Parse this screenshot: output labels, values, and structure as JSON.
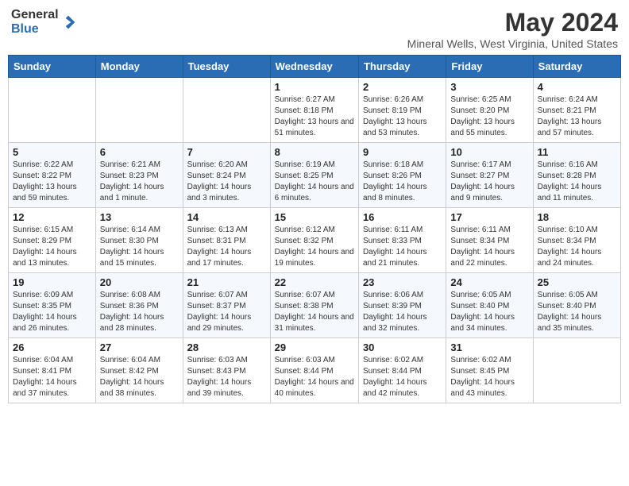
{
  "header": {
    "logo_general": "General",
    "logo_blue": "Blue",
    "main_title": "May 2024",
    "subtitle": "Mineral Wells, West Virginia, United States"
  },
  "days_of_week": [
    "Sunday",
    "Monday",
    "Tuesday",
    "Wednesday",
    "Thursday",
    "Friday",
    "Saturday"
  ],
  "weeks": [
    [
      {
        "day": "",
        "sunrise": "",
        "sunset": "",
        "daylight": ""
      },
      {
        "day": "",
        "sunrise": "",
        "sunset": "",
        "daylight": ""
      },
      {
        "day": "",
        "sunrise": "",
        "sunset": "",
        "daylight": ""
      },
      {
        "day": "1",
        "sunrise": "Sunrise: 6:27 AM",
        "sunset": "Sunset: 8:18 PM",
        "daylight": "Daylight: 13 hours and 51 minutes."
      },
      {
        "day": "2",
        "sunrise": "Sunrise: 6:26 AM",
        "sunset": "Sunset: 8:19 PM",
        "daylight": "Daylight: 13 hours and 53 minutes."
      },
      {
        "day": "3",
        "sunrise": "Sunrise: 6:25 AM",
        "sunset": "Sunset: 8:20 PM",
        "daylight": "Daylight: 13 hours and 55 minutes."
      },
      {
        "day": "4",
        "sunrise": "Sunrise: 6:24 AM",
        "sunset": "Sunset: 8:21 PM",
        "daylight": "Daylight: 13 hours and 57 minutes."
      }
    ],
    [
      {
        "day": "5",
        "sunrise": "Sunrise: 6:22 AM",
        "sunset": "Sunset: 8:22 PM",
        "daylight": "Daylight: 13 hours and 59 minutes."
      },
      {
        "day": "6",
        "sunrise": "Sunrise: 6:21 AM",
        "sunset": "Sunset: 8:23 PM",
        "daylight": "Daylight: 14 hours and 1 minute."
      },
      {
        "day": "7",
        "sunrise": "Sunrise: 6:20 AM",
        "sunset": "Sunset: 8:24 PM",
        "daylight": "Daylight: 14 hours and 3 minutes."
      },
      {
        "day": "8",
        "sunrise": "Sunrise: 6:19 AM",
        "sunset": "Sunset: 8:25 PM",
        "daylight": "Daylight: 14 hours and 6 minutes."
      },
      {
        "day": "9",
        "sunrise": "Sunrise: 6:18 AM",
        "sunset": "Sunset: 8:26 PM",
        "daylight": "Daylight: 14 hours and 8 minutes."
      },
      {
        "day": "10",
        "sunrise": "Sunrise: 6:17 AM",
        "sunset": "Sunset: 8:27 PM",
        "daylight": "Daylight: 14 hours and 9 minutes."
      },
      {
        "day": "11",
        "sunrise": "Sunrise: 6:16 AM",
        "sunset": "Sunset: 8:28 PM",
        "daylight": "Daylight: 14 hours and 11 minutes."
      }
    ],
    [
      {
        "day": "12",
        "sunrise": "Sunrise: 6:15 AM",
        "sunset": "Sunset: 8:29 PM",
        "daylight": "Daylight: 14 hours and 13 minutes."
      },
      {
        "day": "13",
        "sunrise": "Sunrise: 6:14 AM",
        "sunset": "Sunset: 8:30 PM",
        "daylight": "Daylight: 14 hours and 15 minutes."
      },
      {
        "day": "14",
        "sunrise": "Sunrise: 6:13 AM",
        "sunset": "Sunset: 8:31 PM",
        "daylight": "Daylight: 14 hours and 17 minutes."
      },
      {
        "day": "15",
        "sunrise": "Sunrise: 6:12 AM",
        "sunset": "Sunset: 8:32 PM",
        "daylight": "Daylight: 14 hours and 19 minutes."
      },
      {
        "day": "16",
        "sunrise": "Sunrise: 6:11 AM",
        "sunset": "Sunset: 8:33 PM",
        "daylight": "Daylight: 14 hours and 21 minutes."
      },
      {
        "day": "17",
        "sunrise": "Sunrise: 6:11 AM",
        "sunset": "Sunset: 8:34 PM",
        "daylight": "Daylight: 14 hours and 22 minutes."
      },
      {
        "day": "18",
        "sunrise": "Sunrise: 6:10 AM",
        "sunset": "Sunset: 8:34 PM",
        "daylight": "Daylight: 14 hours and 24 minutes."
      }
    ],
    [
      {
        "day": "19",
        "sunrise": "Sunrise: 6:09 AM",
        "sunset": "Sunset: 8:35 PM",
        "daylight": "Daylight: 14 hours and 26 minutes."
      },
      {
        "day": "20",
        "sunrise": "Sunrise: 6:08 AM",
        "sunset": "Sunset: 8:36 PM",
        "daylight": "Daylight: 14 hours and 28 minutes."
      },
      {
        "day": "21",
        "sunrise": "Sunrise: 6:07 AM",
        "sunset": "Sunset: 8:37 PM",
        "daylight": "Daylight: 14 hours and 29 minutes."
      },
      {
        "day": "22",
        "sunrise": "Sunrise: 6:07 AM",
        "sunset": "Sunset: 8:38 PM",
        "daylight": "Daylight: 14 hours and 31 minutes."
      },
      {
        "day": "23",
        "sunrise": "Sunrise: 6:06 AM",
        "sunset": "Sunset: 8:39 PM",
        "daylight": "Daylight: 14 hours and 32 minutes."
      },
      {
        "day": "24",
        "sunrise": "Sunrise: 6:05 AM",
        "sunset": "Sunset: 8:40 PM",
        "daylight": "Daylight: 14 hours and 34 minutes."
      },
      {
        "day": "25",
        "sunrise": "Sunrise: 6:05 AM",
        "sunset": "Sunset: 8:40 PM",
        "daylight": "Daylight: 14 hours and 35 minutes."
      }
    ],
    [
      {
        "day": "26",
        "sunrise": "Sunrise: 6:04 AM",
        "sunset": "Sunset: 8:41 PM",
        "daylight": "Daylight: 14 hours and 37 minutes."
      },
      {
        "day": "27",
        "sunrise": "Sunrise: 6:04 AM",
        "sunset": "Sunset: 8:42 PM",
        "daylight": "Daylight: 14 hours and 38 minutes."
      },
      {
        "day": "28",
        "sunrise": "Sunrise: 6:03 AM",
        "sunset": "Sunset: 8:43 PM",
        "daylight": "Daylight: 14 hours and 39 minutes."
      },
      {
        "day": "29",
        "sunrise": "Sunrise: 6:03 AM",
        "sunset": "Sunset: 8:44 PM",
        "daylight": "Daylight: 14 hours and 40 minutes."
      },
      {
        "day": "30",
        "sunrise": "Sunrise: 6:02 AM",
        "sunset": "Sunset: 8:44 PM",
        "daylight": "Daylight: 14 hours and 42 minutes."
      },
      {
        "day": "31",
        "sunrise": "Sunrise: 6:02 AM",
        "sunset": "Sunset: 8:45 PM",
        "daylight": "Daylight: 14 hours and 43 minutes."
      },
      {
        "day": "",
        "sunrise": "",
        "sunset": "",
        "daylight": ""
      }
    ]
  ]
}
